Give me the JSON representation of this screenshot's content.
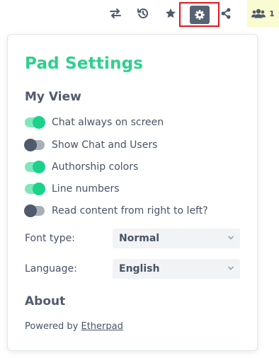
{
  "toolbar": {
    "icons": [
      "import-export-icon",
      "history-icon",
      "star-icon",
      "gear-icon",
      "share-icon",
      "users-icon"
    ],
    "user_count": "1",
    "highlight_color": "#e8141c"
  },
  "settings": {
    "title": "Pad Settings",
    "my_view_heading": "My View",
    "toggles": [
      {
        "label": "Chat always on screen",
        "on": true
      },
      {
        "label": "Show Chat and Users",
        "on": false
      },
      {
        "label": "Authorship colors",
        "on": true
      },
      {
        "label": "Line numbers",
        "on": true
      },
      {
        "label": "Read content from right to left?",
        "on": false
      }
    ],
    "font_type_label": "Font type:",
    "font_type_value": "Normal",
    "language_label": "Language:",
    "language_value": "English",
    "about_heading": "About",
    "powered_by": "Powered by",
    "powered_by_link": "Etherpad"
  },
  "colors": {
    "accent": "#2ed08e",
    "toggle_on": "#1bd28a",
    "toggle_off": "#4f5a6c",
    "text": "#485365"
  }
}
